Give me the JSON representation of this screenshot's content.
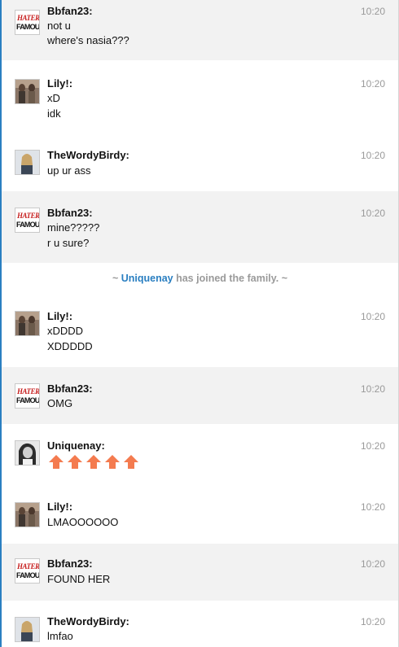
{
  "messages": [
    {
      "user": "Bbfan23:",
      "time": "10:20",
      "lines": [
        "not u",
        "where's nasia???"
      ],
      "avatar": "haters-famous"
    },
    {
      "user": "Lily!:",
      "time": "10:20",
      "lines": [
        "xD",
        "idk"
      ],
      "avatar": "group-photo"
    },
    {
      "user": "TheWordyBirdy:",
      "time": "10:20",
      "lines": [
        "up ur ass"
      ],
      "avatar": "portrait-photo"
    },
    {
      "user": "Bbfan23:",
      "time": "10:20",
      "lines": [
        "mine?????",
        "r u sure?"
      ],
      "avatar": "haters-famous"
    },
    {
      "user": "Lily!:",
      "time": "10:20",
      "lines": [
        "xDDDD",
        "XDDDDD"
      ],
      "avatar": "group-photo"
    },
    {
      "user": "Bbfan23:",
      "time": "10:20",
      "lines": [
        "OMG"
      ],
      "avatar": "haters-famous"
    },
    {
      "user": "Uniquenay:",
      "time": "10:20",
      "lines": [],
      "avatar": "bw-portrait",
      "emoji": [
        "up-arrow-icon",
        "up-arrow-icon",
        "up-arrow-icon",
        "up-arrow-icon",
        "up-arrow-icon"
      ]
    },
    {
      "user": "Lily!:",
      "time": "10:20",
      "lines": [
        "LMAOOOOOO"
      ],
      "avatar": "group-photo"
    },
    {
      "user": "Bbfan23:",
      "time": "10:20",
      "lines": [
        "FOUND HER"
      ],
      "avatar": "haters-famous"
    },
    {
      "user": "TheWordyBirdy:",
      "time": "10:20",
      "lines": [
        "lmfao"
      ],
      "avatar": "portrait-photo"
    }
  ],
  "system": {
    "prefix": "~ ",
    "name": "Uniquenay",
    "text": " has joined the family. ~"
  },
  "avatar_text": {
    "line1": "HATERS",
    "line2": "FAMOUS"
  },
  "colors": {
    "accent": "#2a7fc1",
    "arrow": "#f47b4f",
    "alt_row": "#f2f2f2"
  }
}
